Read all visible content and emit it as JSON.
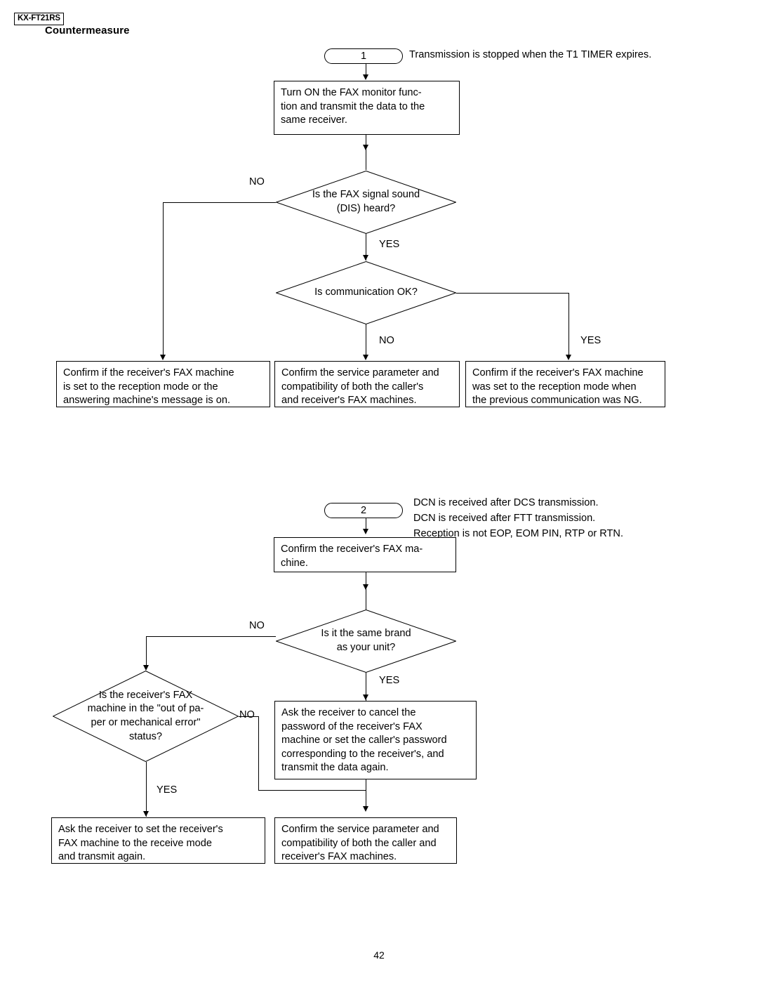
{
  "header": {
    "model_tag": "KX-FT21RS",
    "section_title": "Countermeasure"
  },
  "footer": {
    "page_number": "42"
  },
  "flowcharts": [
    {
      "id": "chart-1",
      "terminator": "1",
      "note": "Transmission is stopped when the T1 TIMER expires.",
      "process_1": "Turn ON the FAX monitor func-\ntion and transmit the data to the\nsame receiver.",
      "decision_1": "Is the FAX signal sound\n(DIS) heard?",
      "decision_1_no": "NO",
      "decision_1_yes": "YES",
      "decision_2": "Is communication OK?",
      "decision_2_no": "NO",
      "decision_2_yes": "YES",
      "result_left": "Confirm if the receiver's FAX machine\nis set to the reception mode or the\nanswering machine's message is on.",
      "result_center": "Confirm the service parameter and\ncompatibility of both the caller's\nand receiver's FAX machines.",
      "result_right": "Confirm if the receiver's FAX machine\nwas set to the reception mode when\nthe previous communication was NG."
    },
    {
      "id": "chart-2",
      "terminator": "2",
      "note": "DCN is received after DCS transmission.\nDCN is received after FTT transmission.\nReception is not EOP, EOM PIN, RTP or RTN.",
      "process_1": "Confirm the receiver's FAX ma-\nchine.",
      "decision_1": "Is it the same brand\nas your unit?",
      "decision_1_no": "NO",
      "decision_1_yes": "YES",
      "decision_2": "Is the receiver's FAX\nmachine in the \"out of pa-\nper or mechanical error\"\nstatus?",
      "decision_2_no": "NO",
      "decision_2_yes": "YES",
      "action_right": "Ask the receiver to cancel the\npassword of the receiver's FAX\nmachine or set the caller's password\ncorresponding to the receiver's, and\ntransmit the data again.",
      "result_left": "Ask the receiver to set the receiver's\nFAX machine to the receive mode\nand transmit again.",
      "result_center": "Confirm the service parameter and\ncompatibility of both the caller and\nreceiver's FAX machines."
    }
  ]
}
